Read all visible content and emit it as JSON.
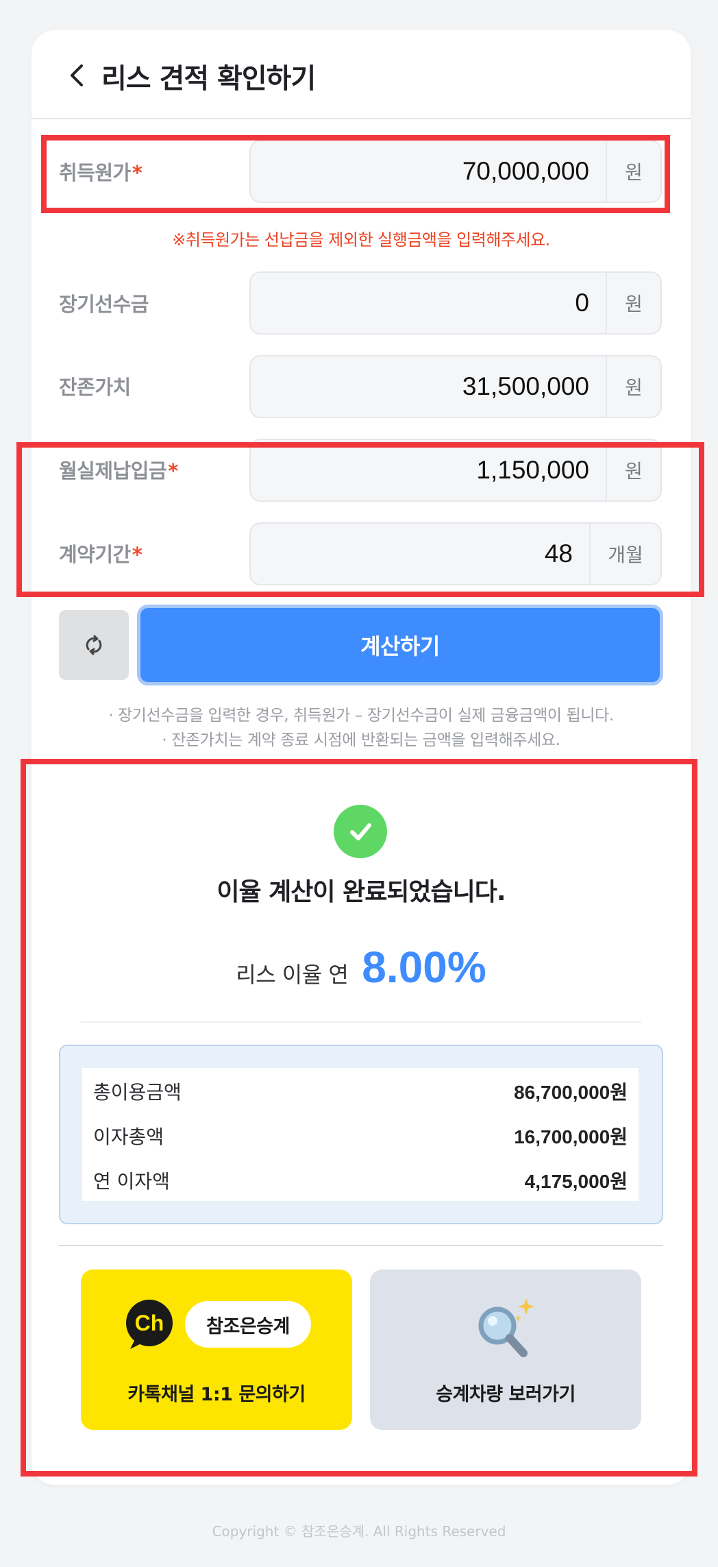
{
  "header": {
    "title": "리스 견적 확인하기"
  },
  "form": {
    "acquisition": {
      "label": "취득원가",
      "required": "*",
      "value": "70,000,000",
      "unit": "원"
    },
    "acquisition_note": "※취득원가는 선납금을 제외한 실행금액을 입력해주세요.",
    "advance": {
      "label": "장기선수금",
      "value": "0",
      "unit": "원"
    },
    "residual": {
      "label": "잔존가치",
      "value": "31,500,000",
      "unit": "원"
    },
    "monthly": {
      "label": "월실제납입금",
      "required": "*",
      "value": "1,150,000",
      "unit": "원"
    },
    "term": {
      "label": "계약기간",
      "required": "*",
      "value": "48",
      "unit": "개월"
    }
  },
  "actions": {
    "calculate_label": "계산하기"
  },
  "hints": [
    "· 장기선수금을 입력한 경우, 취득원가 – 장기선수금이 실제 금융금액이 됩니다.",
    "· 잔존가치는 계약 종료 시점에 반환되는 금액을 입력해주세요."
  ],
  "result": {
    "title": "이율 계산이 완료되었습니다.",
    "rate_label": "리스 이율 연",
    "rate_value": "8.00%",
    "rows": [
      {
        "label": "총이용금액",
        "amount": "86,700,000원"
      },
      {
        "label": "이자총액",
        "amount": "16,700,000원"
      },
      {
        "label": "연 이자액",
        "amount": "4,175,000원"
      }
    ]
  },
  "cta": {
    "kakao_logo_text": "Ch",
    "kakao_channel_name": "참조은승계",
    "kakao_label": "카톡채널 1:1 문의하기",
    "car_label": "승계차량 보러가기"
  },
  "footer": {
    "copyright": "Copyright © 참조은승계. All Rights Reserved"
  },
  "colors": {
    "accent": "#3e8cfd",
    "required": "#ef4a2d",
    "kakao": "#fee500",
    "highlight": "#f0363b",
    "success": "#5ed764"
  },
  "icons": [
    "chevron-left-icon",
    "refresh-icon",
    "check-icon",
    "kakao-channel-icon",
    "magnifier-icon"
  ]
}
